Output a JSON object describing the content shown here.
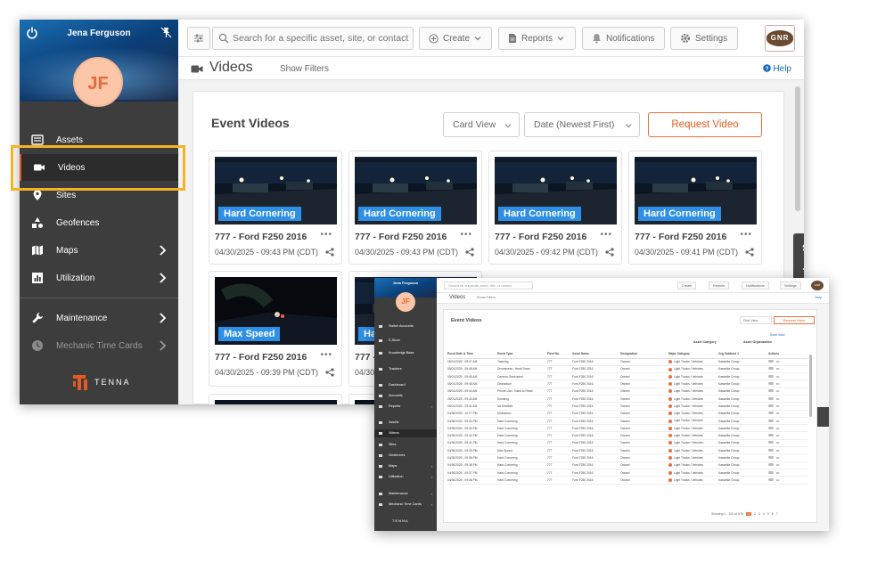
{
  "main_window": {
    "user": {
      "name": "Jena Ferguson",
      "initials": "JF"
    },
    "sidebar": {
      "items": [
        {
          "label": "Assets",
          "icon": "assets-icon"
        },
        {
          "label": "Videos",
          "icon": "video-camera-icon",
          "active": true
        },
        {
          "label": "Sites",
          "icon": "location-pin-icon"
        },
        {
          "label": "Geofences",
          "icon": "geofence-icon"
        },
        {
          "label": "Maps",
          "icon": "map-icon",
          "chevron": true
        },
        {
          "label": "Utilization",
          "icon": "chart-icon",
          "chevron": true
        },
        {
          "label": "Maintenance",
          "icon": "wrench-icon",
          "chevron": true
        },
        {
          "label": "Mechanic Time Cards",
          "icon": "clock-icon",
          "chevron": true,
          "dim": true
        }
      ],
      "logo_text": "TENNA"
    },
    "topbar": {
      "search_placeholder": "Search for a specific asset, site, or contact",
      "create_label": "Create",
      "reports_label": "Reports",
      "notifications_label": "Notifications",
      "settings_label": "Settings",
      "brand_logo_text": "GNR"
    },
    "titlebar": {
      "title": "Videos",
      "show_filters": "Show Filters",
      "help": "Help"
    },
    "panel": {
      "title": "Event Videos",
      "view_select": "Card View",
      "sort_select": "Date (Newest First)",
      "request_button": "Request Video"
    },
    "cards": [
      {
        "event": "Hard Cornering",
        "asset": "777 - Ford F250 2016",
        "date": "04/30/2025 - 09:43 PM (CDT)"
      },
      {
        "event": "Hard Cornering",
        "asset": "777 - Ford F250 2016",
        "date": "04/30/2025 - 09:43 PM (CDT)"
      },
      {
        "event": "Hard Cornering",
        "asset": "777 - Ford F250 2016",
        "date": "04/30/2025 - 09:42 PM (CDT)"
      },
      {
        "event": "Hard Cornering",
        "asset": "777 - Ford F250 2016",
        "date": "04/30/2025 - 09:41 PM (CDT)"
      },
      {
        "event": "Max Speed",
        "asset": "777 - Ford F250 2016",
        "date": "04/30/2025 - 09:39 PM (CDT)"
      },
      {
        "event": "Ha",
        "asset": "777 -",
        "date": "04/30/"
      }
    ]
  },
  "inset_window": {
    "user_name": "Jena Ferguson",
    "initials": "JF",
    "sidebar_items": [
      {
        "label": "Switch Accounts"
      },
      {
        "label": "E-Store"
      },
      {
        "label": "Knowledge Base"
      },
      {
        "label": "Trackers"
      },
      {
        "label": "Dashboard"
      },
      {
        "label": "Accounts"
      },
      {
        "label": "Reports"
      },
      {
        "label": "Assets"
      },
      {
        "label": "Videos",
        "active": true
      },
      {
        "label": "Sites"
      },
      {
        "label": "Geofences"
      },
      {
        "label": "Maps"
      },
      {
        "label": "Utilization"
      },
      {
        "label": "Maintenance"
      },
      {
        "label": "Mechanic Time Cards"
      }
    ],
    "logo_text": "TENNA",
    "search_placeholder": "Search for a specific asset, site, or contact",
    "create_label": "Create",
    "reports_label": "Reports",
    "notifications_label": "Notifications",
    "settings_label": "Settings",
    "brand_logo_text": "GNR",
    "title": "Videos",
    "show_filters": "Show Filters",
    "help": "Help",
    "panel_title": "Event Videos",
    "view_select": "Grid View",
    "request_button": "Request Video",
    "group_headers": [
      "Asset Category",
      "Asset Organization"
    ],
    "tools_label": "Save View",
    "columns": [
      "Event Date & Time",
      "Event Type",
      "Fleet No.",
      "Asset Name",
      "Designation",
      "Major Category",
      "Org Subtract 1",
      "Actions"
    ],
    "rows": [
      [
        "05/01/2025 - 09:47 AM",
        "Yawning",
        "777",
        "Ford F250 2016",
        "Owned",
        "Light Trucks / Vehicles",
        "Kasselke Group"
      ],
      [
        "05/01/2025 - 09:46 AM",
        "Drowsiness / Head Down",
        "777",
        "Ford F250 2016",
        "Owned",
        "Light Trucks / Vehicles",
        "Kasselke Group"
      ],
      [
        "05/01/2025 - 09:46 AM",
        "Camera Obstructed",
        "777",
        "Ford F250 2016",
        "Owned",
        "Light Trucks / Vehicles",
        "Kasselke Group"
      ],
      [
        "05/01/2025 - 09:45 AM",
        "Distraction",
        "777",
        "Ford F250 2016",
        "Owned",
        "Light Trucks / Vehicles",
        "Kasselke Group"
      ],
      [
        "05/01/2025 - 09:44 AM",
        "Phone Use / Hand to Head",
        "777",
        "Ford F250 2016",
        "Owned",
        "Light Trucks / Vehicles",
        "Kasselke Group"
      ],
      [
        "05/01/2025 - 09:43 AM",
        "Smoking",
        "777",
        "Ford F250 2016",
        "Owned",
        "Light Trucks / Vehicles",
        "Kasselke Group"
      ],
      [
        "05/01/2025 - 09:41 AM",
        "No Seatbelt",
        "777",
        "Ford F250 2016",
        "Owned",
        "Light Trucks / Vehicles",
        "Kasselke Group"
      ],
      [
        "04/30/2025 - 10:17 PM",
        "Distraction",
        "777",
        "Ford F250 2016",
        "Owned",
        "Light Trucks / Vehicles",
        "Kasselke Group"
      ],
      [
        "04/30/2025 - 09:43 PM",
        "Hard Cornering",
        "777",
        "Ford F250 2016",
        "Owned",
        "Light Trucks / Vehicles",
        "Kasselke Group"
      ],
      [
        "04/30/2025 - 09:43 PM",
        "Hard Cornering",
        "777",
        "Ford F250 2016",
        "Owned",
        "Light Trucks / Vehicles",
        "Kasselke Group"
      ],
      [
        "04/30/2025 - 09:42 PM",
        "Hard Cornering",
        "777",
        "Ford F250 2016",
        "Owned",
        "Light Trucks / Vehicles",
        "Kasselke Group"
      ],
      [
        "04/30/2025 - 09:41 PM",
        "Hard Cornering",
        "777",
        "Ford F250 2016",
        "Owned",
        "Light Trucks / Vehicles",
        "Kasselke Group"
      ],
      [
        "04/30/2025 - 09:39 PM",
        "Max Speed",
        "777",
        "Ford F250 2016",
        "Owned",
        "Light Trucks / Vehicles",
        "Kasselke Group"
      ],
      [
        "04/30/2025 - 09:38 PM",
        "Hard Cornering",
        "777",
        "Ford F250 2016",
        "Owned",
        "Light Trucks / Vehicles",
        "Kasselke Group"
      ],
      [
        "04/30/2025 - 09:38 PM",
        "Hard Cornering",
        "777",
        "Ford F250 2016",
        "Owned",
        "Light Trucks / Vehicles",
        "Kasselke Group"
      ],
      [
        "04/30/2025 - 09:37 PM",
        "Hard Cornering",
        "777",
        "Ford F250 2016",
        "Owned",
        "Light Trucks / Vehicles",
        "Kasselke Group"
      ],
      [
        "04/30/2025 - 09:36 PM",
        "Hard Cornering",
        "777",
        "Ford F250 2016",
        "Owned",
        "Light Trucks / Vehicles",
        "Kasselke Group"
      ]
    ],
    "footer_showing": "Showing 1 - 100 of 676",
    "pages": [
      "1",
      "2",
      "3",
      "4",
      "5",
      "6",
      "7"
    ],
    "active_page": "1"
  },
  "colors": {
    "accent": "#e55a21",
    "highlight": "#f5b324",
    "tag_blue": "#2d8fe6",
    "sidebar_bg": "#3d3d3d"
  }
}
